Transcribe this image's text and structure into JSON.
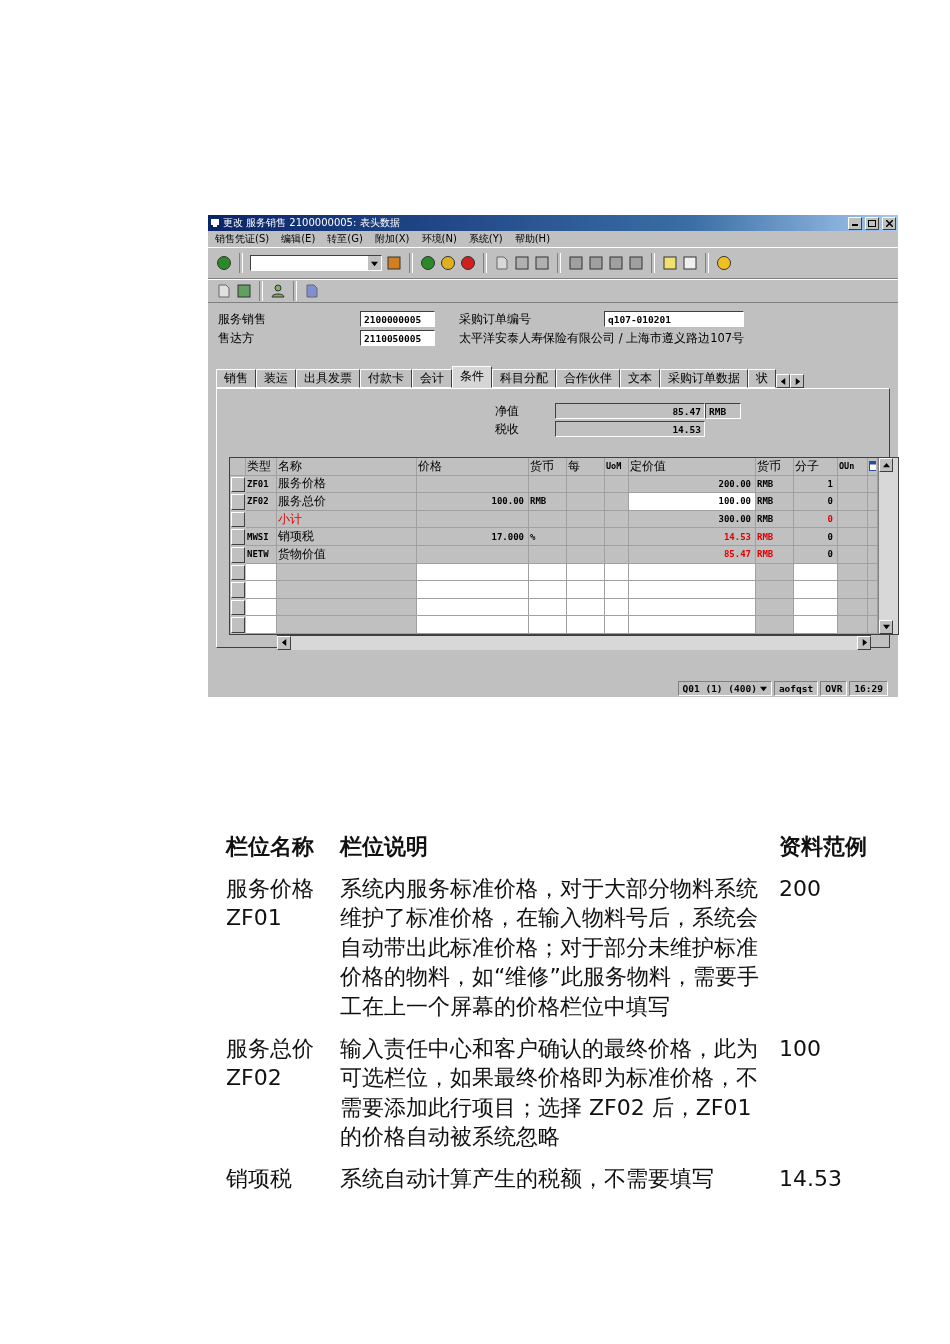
{
  "window": {
    "title": "更改 服务销售 2100000005: 表头数据"
  },
  "menu": [
    "销售凭证(S)",
    "编辑(E)",
    "转至(G)",
    "附加(X)",
    "环境(N)",
    "系统(Y)",
    "帮助(H)"
  ],
  "header": {
    "doc_label": "服务销售",
    "doc_value": "2100000005",
    "po_label": "采购订单编号",
    "po_value": "q107-010201",
    "party_label": "售达方",
    "party_value": "2110050005",
    "party_desc": "太平洋安泰人寿保险有限公司 / 上海市遵义路边107号"
  },
  "tabs": [
    {
      "label": "销售",
      "selected": false
    },
    {
      "label": "装运",
      "selected": false
    },
    {
      "label": "出具发票",
      "selected": false
    },
    {
      "label": "付款卡",
      "selected": false
    },
    {
      "label": "会计",
      "selected": false
    },
    {
      "label": "条件",
      "selected": true
    },
    {
      "label": "科目分配",
      "selected": false
    },
    {
      "label": "合作伙伴",
      "selected": false
    },
    {
      "label": "文本",
      "selected": false
    },
    {
      "label": "采购订单数据",
      "selected": false
    },
    {
      "label": "状",
      "selected": false
    }
  ],
  "totals": {
    "net_label": "净值",
    "net_value": "85.47",
    "net_currency": "RMB",
    "tax_label": "税收",
    "tax_value": "14.53"
  },
  "table": {
    "columns": [
      "类型",
      "名称",
      "价格",
      "货币",
      "每",
      "UoM",
      "定价值",
      "货币",
      "分子",
      "OUn"
    ],
    "rows": [
      {
        "kind": "normal",
        "type": "ZF01",
        "name": "服务价格",
        "value": "200.00",
        "value_currency": "RMB",
        "numerator": "1"
      },
      {
        "kind": "input",
        "type": "ZF02",
        "name": "服务总价",
        "price": "100.00",
        "currency": "RMB",
        "value": "100.00",
        "value_currency": "RMB",
        "numerator": "0"
      },
      {
        "kind": "subtotal",
        "name": "小计",
        "value": "300.00",
        "value_currency": "RMB",
        "numerator": "0"
      },
      {
        "kind": "tax",
        "type": "MWSI",
        "name": "销项税",
        "price": "17.000",
        "currency": "%",
        "value": "14.53",
        "value_currency": "RMB",
        "numerator": "0"
      },
      {
        "kind": "tax",
        "type": "NETW",
        "name": "货物价值",
        "value": "85.47",
        "value_currency": "RMB",
        "numerator": "0"
      },
      {
        "kind": "empty"
      },
      {
        "kind": "empty"
      },
      {
        "kind": "empty"
      },
      {
        "kind": "empty"
      }
    ]
  },
  "status_bar": {
    "system": "Q01 (1) (400)",
    "user": "aofqst",
    "mode": "OVR",
    "time": "16:29"
  },
  "doc_table": {
    "columns": [
      "栏位名称",
      "栏位说明",
      "资料范例"
    ],
    "rows": [
      {
        "field": "服务价格\nZF01",
        "description": "系统内服务标准价格，对于大部分物料系统维护了标准价格，在输入物料号后，系统会自动带出此标准价格；对于部分未维护标准价格的物料，如“维修”此服务物料，需要手工在上一个屏幕的价格栏位中填写",
        "example": "200"
      },
      {
        "field": "服务总价\nZF02",
        "description": "输入责任中心和客户确认的最终价格，此为可选栏位，如果最终价格即为标准价格，不需要添加此行项目；选择 ZF02 后，ZF01 的价格自动被系统忽略",
        "example": "100"
      },
      {
        "field": "销项税",
        "description": "系统自动计算产生的税额，不需要填写",
        "example": "14.53"
      }
    ]
  }
}
